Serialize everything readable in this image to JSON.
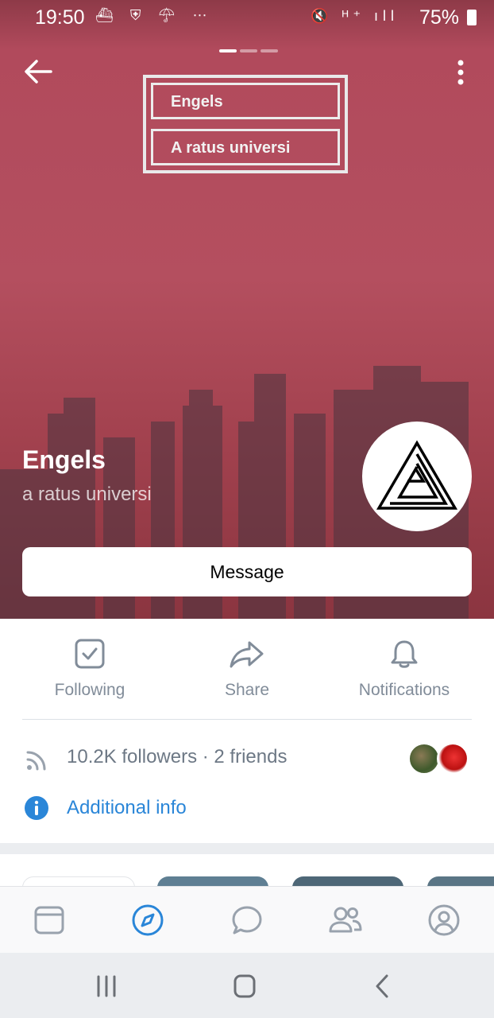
{
  "status_bar": {
    "time": "19:50",
    "battery": "75%",
    "left_icons": [
      "cruise-ship-icon",
      "shield-icon",
      "umbrella-icon",
      "more-dots-icon"
    ],
    "right_icons": [
      "mute-icon",
      "h-plus-icon",
      "signal-icon",
      "battery-icon"
    ]
  },
  "cover": {
    "box1_text": "Engels",
    "box2_text": "A ratus universi",
    "page_indicator_count": 3,
    "page_indicator_active": 0
  },
  "group": {
    "name": "Engels",
    "subtitle": "a ratus universi"
  },
  "message_button": "Message",
  "actions": [
    {
      "label": "Following",
      "icon": "checkbox-icon"
    },
    {
      "label": "Share",
      "icon": "share-icon"
    },
    {
      "label": "Notifications",
      "icon": "bell-icon"
    }
  ],
  "followers_text": "10.2K followers · 2 friends",
  "additional_info": "Additional info",
  "tab_bar": [
    "news-icon",
    "explore-icon",
    "messages-icon",
    "friends-icon",
    "profile-icon"
  ],
  "colors": {
    "accent": "#2a86d8",
    "hero": "#b44f5f",
    "muted": "#818c99"
  }
}
